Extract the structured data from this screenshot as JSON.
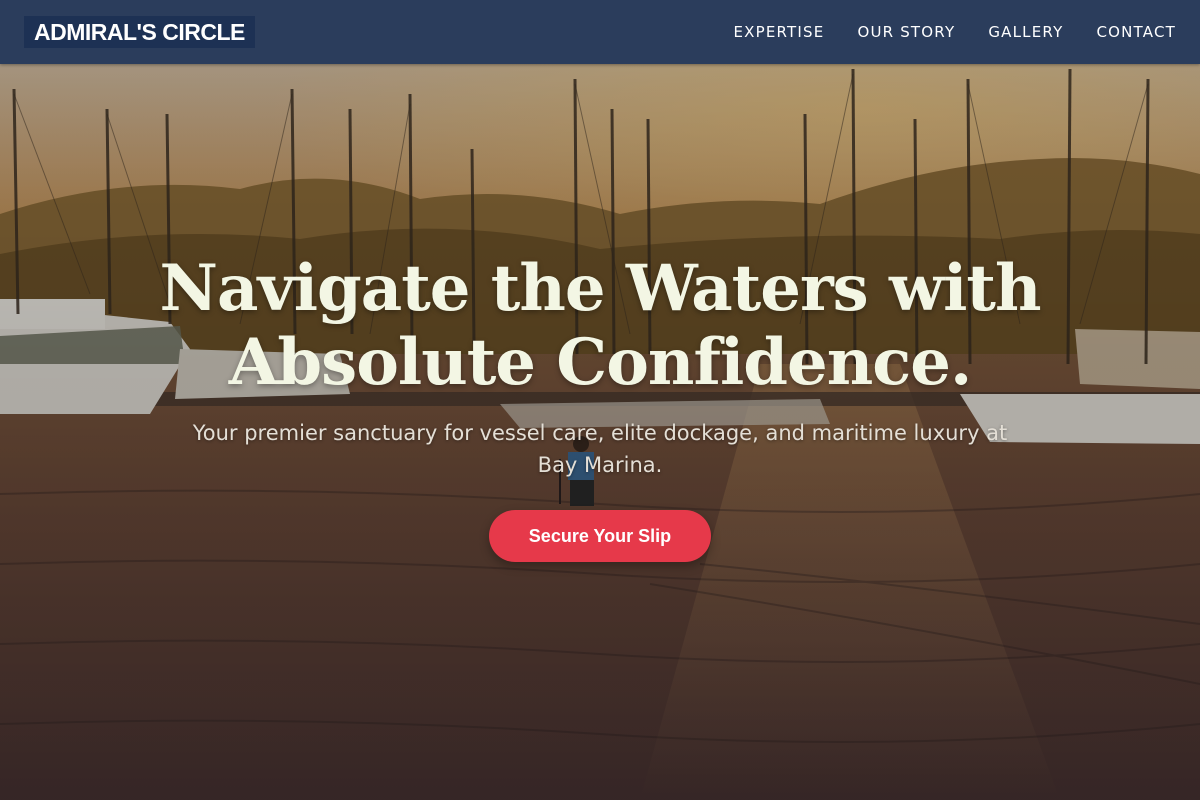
{
  "nav": {
    "logo": "ADMIRAL'S CIRCLE",
    "links": [
      "EXPERTISE",
      "OUR STORY",
      "GALLERY",
      "CONTACT"
    ]
  },
  "hero": {
    "headline": "Navigate the Waters with Absolute Confidence.",
    "subline": "Your premier sanctuary for vessel care, elite dockage, and maritime luxury at Bay Marina.",
    "cta_label": "Secure Your Slip",
    "background_image": "marina-sunset-photo"
  },
  "colors": {
    "nav_bg": "#2b3d5c",
    "logo_bg": "#1d3154",
    "headline": "#f3f6e4",
    "cta": "#e6394a"
  }
}
